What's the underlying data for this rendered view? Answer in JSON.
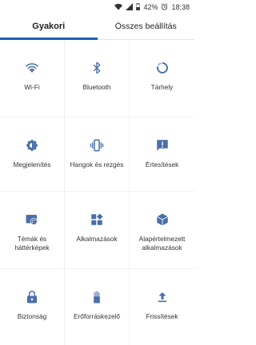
{
  "status_bar": {
    "battery_pct": "42%",
    "clock": "18:38"
  },
  "tabs": [
    {
      "label": "Gyakori",
      "active": true
    },
    {
      "label": "Összes beállítás",
      "active": false
    }
  ],
  "accent_color": "#1f5fb5",
  "icon_color": "#4a6fa8",
  "tiles": [
    {
      "label": "Wi-Fi",
      "icon": "wifi-icon"
    },
    {
      "label": "Bluetooth",
      "icon": "bluetooth-icon"
    },
    {
      "label": "Tárhely",
      "icon": "storage-icon"
    },
    {
      "label": "Megjelenítés",
      "icon": "display-icon"
    },
    {
      "label": "Hangok és rezgés",
      "icon": "vibration-icon"
    },
    {
      "label": "Értesítések",
      "icon": "notification-icon"
    },
    {
      "label": "Témák és háttérképek",
      "icon": "themes-icon"
    },
    {
      "label": "Alkalmazások",
      "icon": "apps-icon"
    },
    {
      "label": "Alapértelmezett alkalmazások",
      "icon": "default-apps-icon"
    },
    {
      "label": "Biztonság",
      "icon": "lock-icon"
    },
    {
      "label": "Erőforráskezelő",
      "icon": "battery-icon"
    },
    {
      "label": "Frissítések",
      "icon": "update-icon"
    }
  ]
}
